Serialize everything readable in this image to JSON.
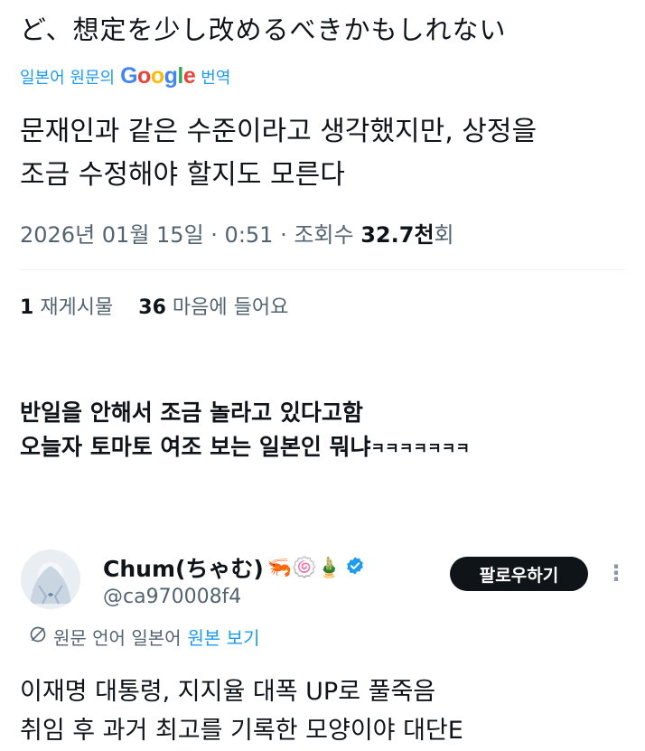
{
  "prev_tweet": {
    "japanese_tail": "ど、想定を少し改めるべきかもしれない",
    "translated_from": "일본어 원문의",
    "translated_by": "번역",
    "translated_body_1": "문재인과 같은 수준이라고 생각했지만, 상정을",
    "translated_body_2": "조금 수정해야 할지도 모른다",
    "date": "2026년 01월 15일",
    "time": "0:51",
    "views_label": "조회수",
    "views_value": "32.7천",
    "views_suffix": "회",
    "reposts_count": "1",
    "reposts_label": "재게시물",
    "likes_count": "36",
    "likes_label": "마음에 들어요"
  },
  "comment": {
    "line1": "반일을 안해서 조금 놀라고 있다고함",
    "line2": "오늘자 토마토 여조 보는 일본인 뭐냐",
    "laugh": "ㅋㅋㅋㅋㅋㅋㅋ"
  },
  "next_tweet": {
    "display_name": "Chum(ちゃむ)",
    "emojis": "🦐🍥🎍",
    "handle": "@ca970008f4",
    "follow_label": "팔로우하기",
    "lang_note": "원문 언어 일본어",
    "view_original": "원본 보기",
    "body_1": "이재명 대통령, 지지율 대폭 UP로 풀죽음",
    "body_2": "취임 후 과거 최고를 기록한 모양이야 대단E"
  },
  "icons": [
    "google-logo",
    "verified-badge-icon",
    "more-dots-icon",
    "translate-globe-icon",
    "avatar"
  ],
  "colors": {
    "link": "#1d9bf0",
    "text": "#0f1419",
    "muted": "#536471",
    "verified": "#1d9bf0",
    "button": "#0f1419"
  }
}
